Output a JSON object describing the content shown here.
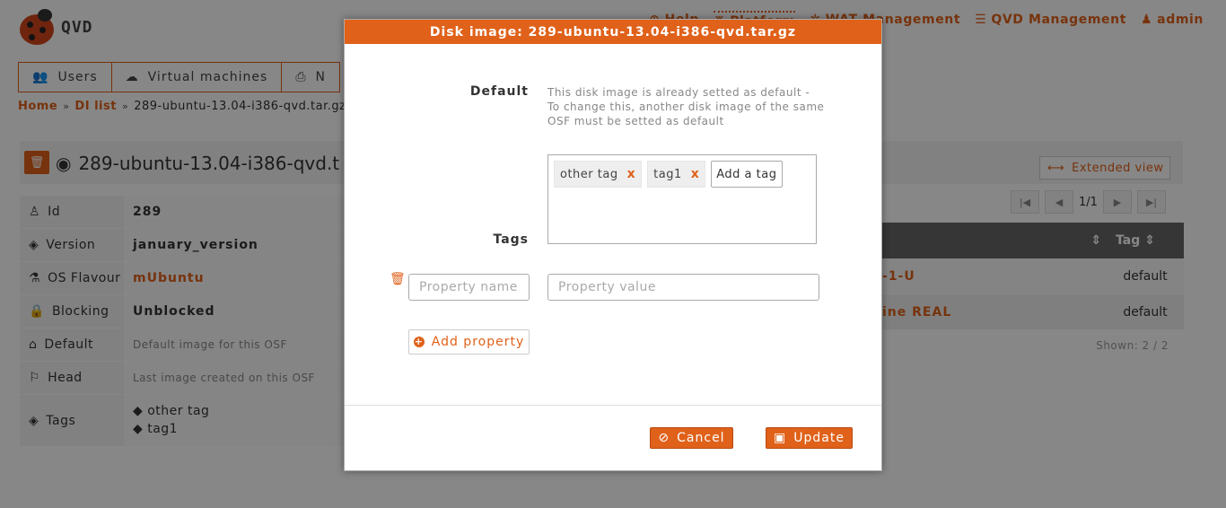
{
  "app": {
    "logo_text": "QVD",
    "topnav": [
      {
        "label": "Help",
        "icon": "life-ring-icon"
      },
      {
        "label": "Platform",
        "icon": "platform-icon"
      },
      {
        "label": "WAT Management",
        "icon": "wrench-icon"
      },
      {
        "label": "QVD Management",
        "icon": "sliders-icon"
      },
      {
        "label": "admin",
        "icon": "user-icon"
      }
    ],
    "tabs": [
      {
        "label": "Users",
        "icon": "users-icon"
      },
      {
        "label": "Virtual machines",
        "icon": "cloud-icon"
      },
      {
        "label": "N",
        "icon": "printer-icon"
      }
    ],
    "breadcrumb": {
      "home": "Home",
      "list": "DI list",
      "current": "289-ubuntu-13.04-i386-qvd.tar.gz"
    },
    "detail_title": "289-ubuntu-13.04-i386-qvd.t",
    "properties": [
      {
        "key": "Id",
        "value": "289"
      },
      {
        "key": "Version",
        "value": "january_version"
      },
      {
        "key": "OS Flavour",
        "value": "mUbuntu"
      },
      {
        "key": "Blocking",
        "value": "Unblocked"
      },
      {
        "key": "Default",
        "value": "Default image for this OSF"
      },
      {
        "key": "Head",
        "value": "Last image created on this OSF"
      },
      {
        "key": "Tags",
        "values": [
          "other tag",
          "tag1"
        ]
      }
    ],
    "extended_view": "Extended view",
    "pager": "1/1",
    "vm_table": {
      "headers": [
        "Tag"
      ],
      "rows": [
        {
          "name": "-1-U",
          "tag": "default"
        },
        {
          "name": "ine REAL",
          "tag": "default"
        }
      ],
      "shown": "Shown: 2 / 2"
    }
  },
  "modal": {
    "title": "Disk image: 289-ubuntu-13.04-i386-qvd.tar.gz",
    "default_label": "Default",
    "default_text": "This disk image is already setted as default - To change this, another disk image of the same OSF must be setted as default",
    "tags_label": "Tags",
    "tags": [
      "other tag",
      "tag1"
    ],
    "tag_remove": "x",
    "tag_input_placeholder": "Add a tag",
    "property_name_placeholder": "Property name",
    "property_value_placeholder": "Property value",
    "add_property": "Add property",
    "cancel": "Cancel",
    "update": "Update"
  },
  "colors": {
    "accent": "#e0611a",
    "overlay": "rgba(0,0,0,0.47)"
  }
}
